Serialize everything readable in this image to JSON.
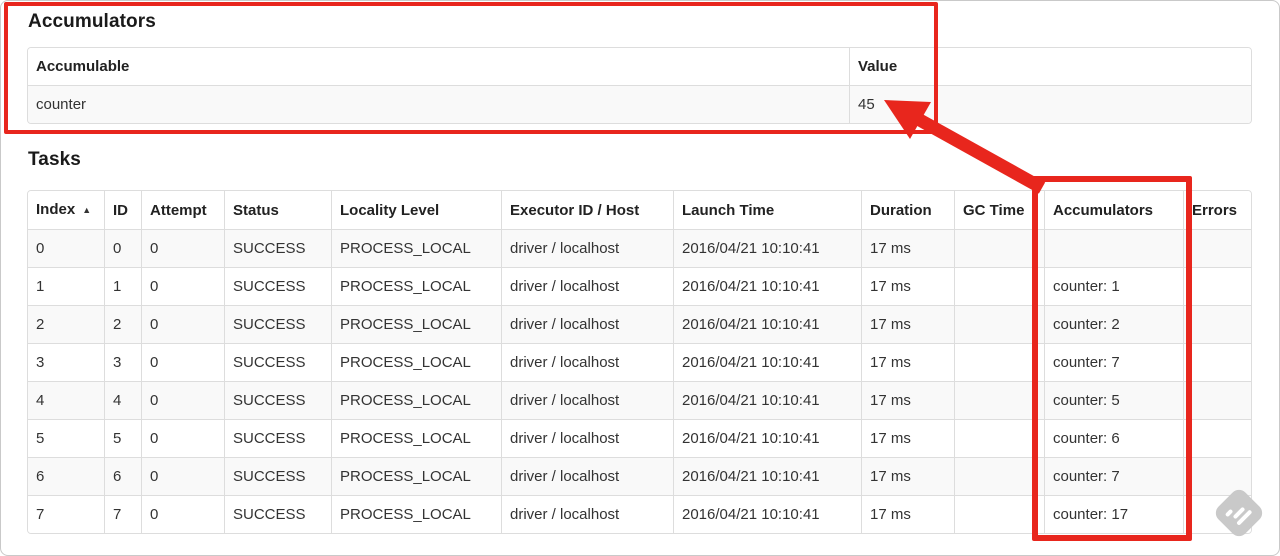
{
  "accumulators_section": {
    "title": "Accumulators",
    "table": {
      "headers": [
        "Accumulable",
        "Value"
      ],
      "rows": [
        [
          "counter",
          "45"
        ]
      ]
    }
  },
  "tasks_section": {
    "title": "Tasks",
    "table": {
      "headers": [
        "Index",
        "ID",
        "Attempt",
        "Status",
        "Locality Level",
        "Executor ID / Host",
        "Launch Time",
        "Duration",
        "GC Time",
        "Accumulators",
        "Errors"
      ],
      "sort_indicator": "▲",
      "sorted_column": "Index",
      "rows": [
        [
          "0",
          "0",
          "0",
          "SUCCESS",
          "PROCESS_LOCAL",
          "driver / localhost",
          "2016/04/21 10:10:41",
          "17 ms",
          "",
          "",
          ""
        ],
        [
          "1",
          "1",
          "0",
          "SUCCESS",
          "PROCESS_LOCAL",
          "driver / localhost",
          "2016/04/21 10:10:41",
          "17 ms",
          "",
          "counter: 1",
          ""
        ],
        [
          "2",
          "2",
          "0",
          "SUCCESS",
          "PROCESS_LOCAL",
          "driver / localhost",
          "2016/04/21 10:10:41",
          "17 ms",
          "",
          "counter: 2",
          ""
        ],
        [
          "3",
          "3",
          "0",
          "SUCCESS",
          "PROCESS_LOCAL",
          "driver / localhost",
          "2016/04/21 10:10:41",
          "17 ms",
          "",
          "counter: 7",
          ""
        ],
        [
          "4",
          "4",
          "0",
          "SUCCESS",
          "PROCESS_LOCAL",
          "driver / localhost",
          "2016/04/21 10:10:41",
          "17 ms",
          "",
          "counter: 5",
          ""
        ],
        [
          "5",
          "5",
          "0",
          "SUCCESS",
          "PROCESS_LOCAL",
          "driver / localhost",
          "2016/04/21 10:10:41",
          "17 ms",
          "",
          "counter: 6",
          ""
        ],
        [
          "6",
          "6",
          "0",
          "SUCCESS",
          "PROCESS_LOCAL",
          "driver / localhost",
          "2016/04/21 10:10:41",
          "17 ms",
          "",
          "counter: 7",
          ""
        ],
        [
          "7",
          "7",
          "0",
          "SUCCESS",
          "PROCESS_LOCAL",
          "driver / localhost",
          "2016/04/21 10:10:41",
          "17 ms",
          "",
          "counter: 17",
          ""
        ]
      ]
    }
  },
  "annotations": {
    "color": "#e8261d",
    "arrow_points_at": "45",
    "boxed_regions": [
      "Accumulators section",
      "Accumulators column"
    ]
  },
  "watermark": {
    "icon": "skitch-pen-icon"
  }
}
